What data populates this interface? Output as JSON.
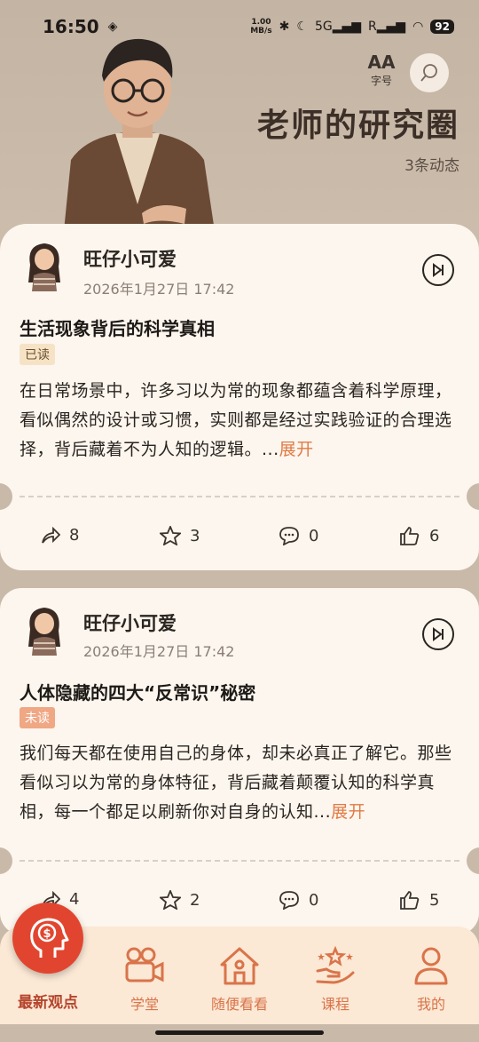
{
  "status_bar": {
    "time": "16:50",
    "net_speed_value": "1.00",
    "net_speed_unit": "MB/s",
    "signal_1": "5G",
    "signal_2": "R",
    "battery": "92"
  },
  "header": {
    "font_size_icon": "AA",
    "font_size_label": "字号",
    "title": "老师的研究圈",
    "count": "3条动态"
  },
  "posts": [
    {
      "author": "旺仔小可爱",
      "date": "2026年1月27日 17:42",
      "title": "生活现象背后的科学真相",
      "status": "已读",
      "body": "在日常场景中，许多习以为常的现象都蕴含着科学原理，看似偶然的设计或习惯，实则都是经过实践验证的合理选择，背后藏着不为人知的逻辑。...",
      "expand": "展开",
      "shares": "8",
      "stars": "3",
      "comments": "0",
      "likes": "6"
    },
    {
      "author": "旺仔小可爱",
      "date": "2026年1月27日 17:42",
      "title": "人体隐藏的四大“反常识”秘密",
      "status": "未读",
      "body": "我们每天都在使用自己的身体，却未必真正了解它。那些看似习以为常的身体特征，背后藏着颠覆认知的科学真相，每一个都足以刷新你对自身的认知...",
      "expand": "展开",
      "shares": "4",
      "stars": "2",
      "comments": "0",
      "likes": "5"
    }
  ],
  "tabbar": {
    "active": "最新观点",
    "items": [
      "学堂",
      "随便看看",
      "课程",
      "我的"
    ]
  },
  "colors": {
    "accent": "#e07a45",
    "fab": "#e2452f",
    "background": "#c9b9a8",
    "card": "#fcf6ee"
  }
}
